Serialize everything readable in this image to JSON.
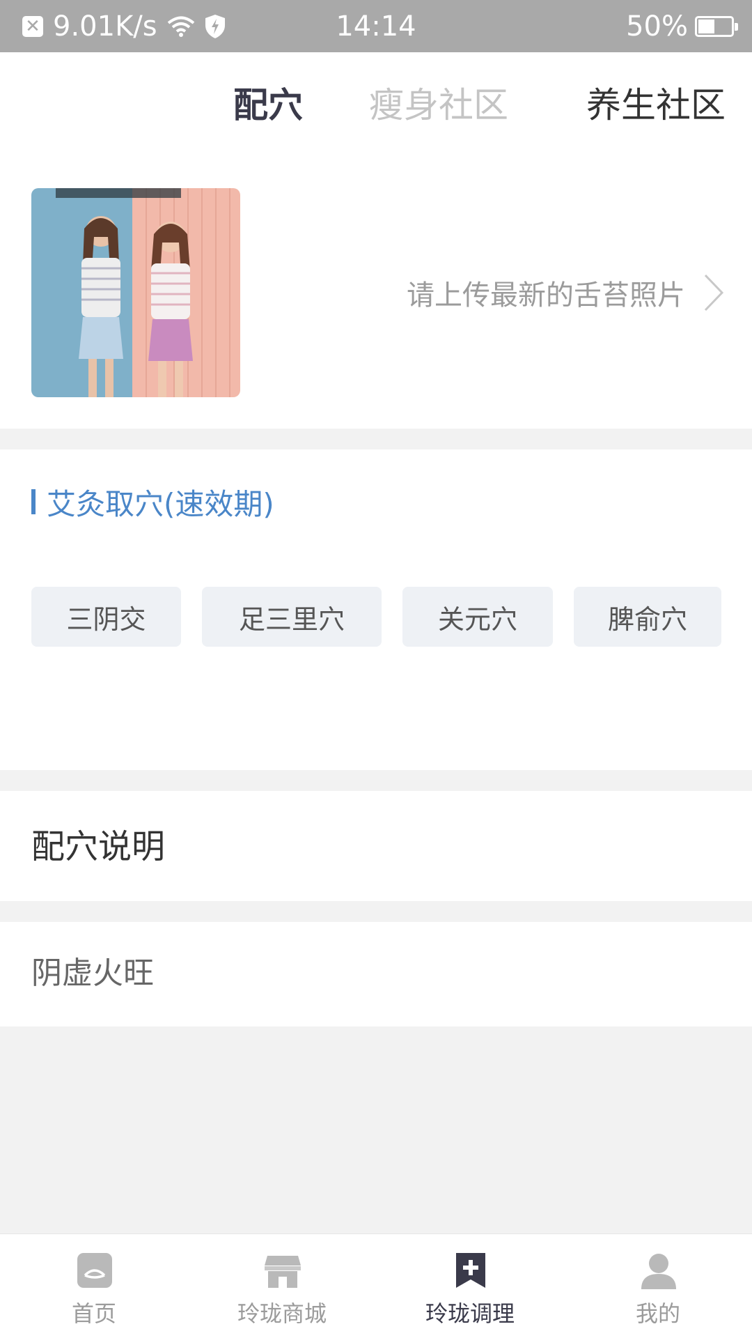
{
  "status_bar": {
    "speed": "9.01K/s",
    "time": "14:14",
    "battery": "50%",
    "battery_level": 0.5,
    "icons": [
      "close-notification-icon",
      "wifi-icon",
      "shield-icon",
      "battery-icon"
    ]
  },
  "top_tabs": [
    {
      "label": "配穴",
      "state": "active"
    },
    {
      "label": "瘦身社区",
      "state": "muted"
    },
    {
      "label": "养生社区",
      "state": "normal"
    }
  ],
  "upload": {
    "prompt": "请上传最新的舌苔照片",
    "icon": "chevron-right-icon"
  },
  "acupoint_section": {
    "title": "艾灸取穴(速效期)",
    "chips": [
      "三阴交",
      "足三里穴",
      "关元穴",
      "脾俞穴"
    ]
  },
  "description": {
    "title": "配穴说明",
    "condition": "阴虚火旺"
  },
  "bottom_tabs": [
    {
      "label": "首页",
      "icon": "home-icon"
    },
    {
      "label": "玲珑商城",
      "icon": "store-icon"
    },
    {
      "label": "玲珑调理",
      "icon": "bookmark-plus-icon",
      "active": true
    },
    {
      "label": "我的",
      "icon": "user-icon"
    }
  ],
  "colors": {
    "accent": "#4a86c8",
    "status_bar": "#a9a9a9",
    "chip_bg": "#eef1f5",
    "active_tab": "#3a3a4a",
    "inactive": "#9b9b9b"
  }
}
